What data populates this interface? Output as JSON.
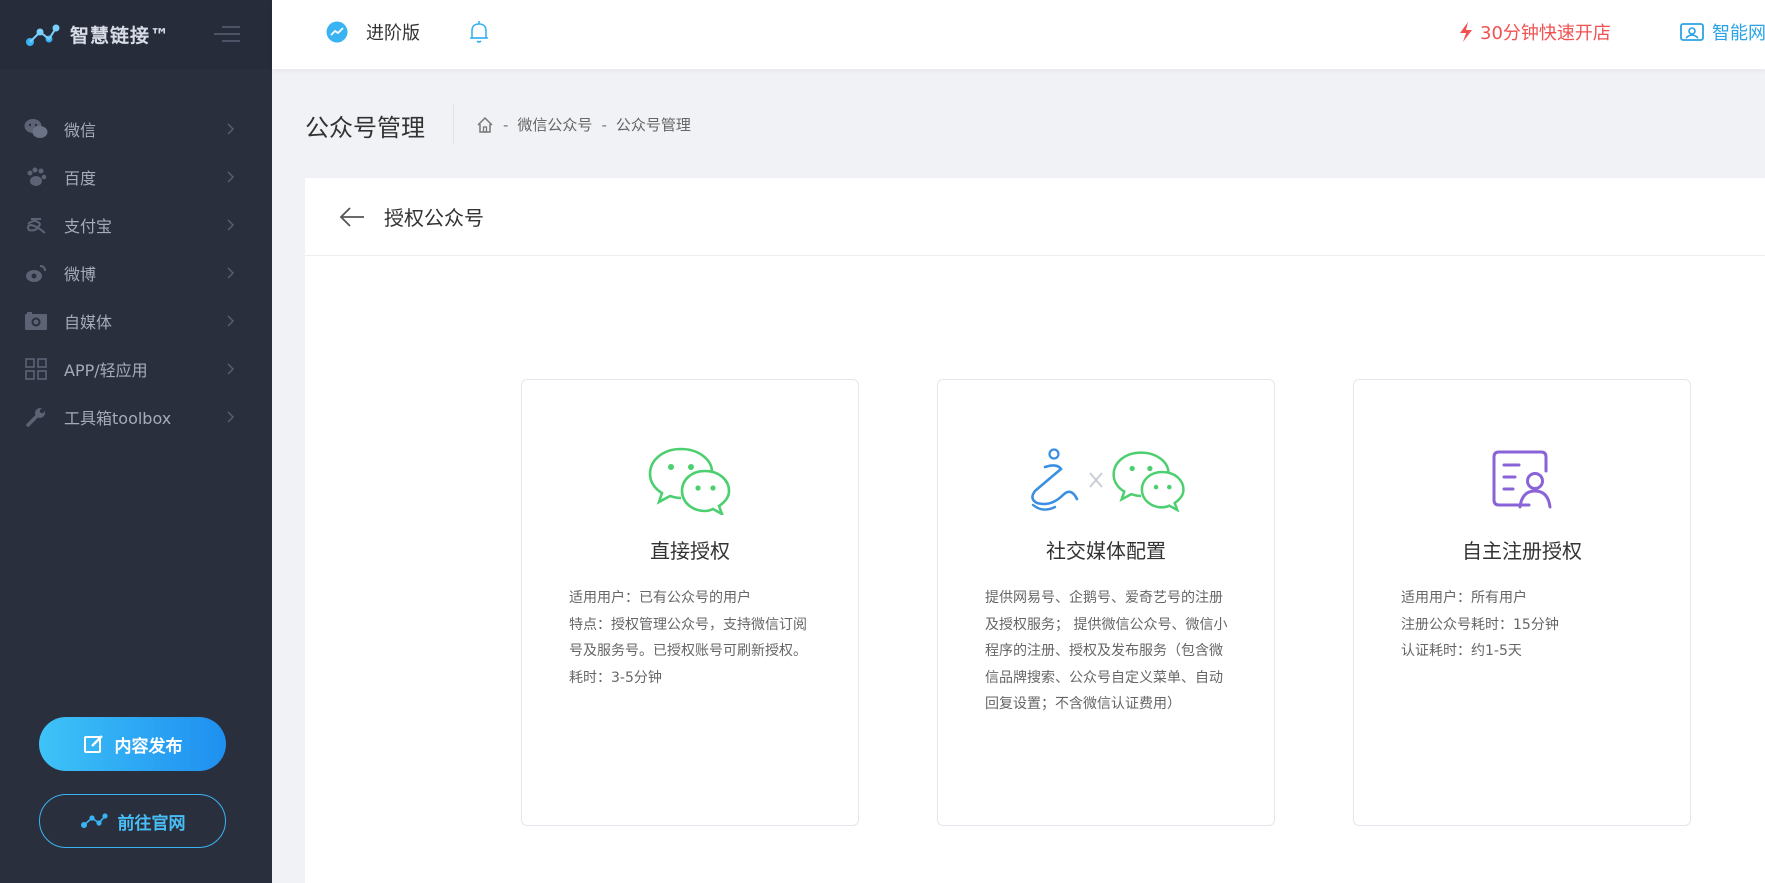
{
  "sidebar": {
    "brand": "智慧链接™",
    "items": [
      {
        "label": "微信",
        "icon": "wechat-icon"
      },
      {
        "label": "百度",
        "icon": "baidu-paw-icon"
      },
      {
        "label": "支付宝",
        "icon": "alipay-icon"
      },
      {
        "label": "微博",
        "icon": "weibo-icon"
      },
      {
        "label": "自媒体",
        "icon": "media-icon"
      },
      {
        "label": "APP/轻应用",
        "icon": "app-grid-icon"
      },
      {
        "label": "工具箱toolbox",
        "icon": "wrench-icon"
      }
    ],
    "publish_label": "内容发布",
    "site_label": "前往官网"
  },
  "topbar": {
    "edition": "进阶版",
    "quick_open": "30分钟快速开店",
    "smart": "智能网"
  },
  "header": {
    "title": "公众号管理",
    "breadcrumb": [
      "微信公众号",
      "公众号管理"
    ],
    "sep": "-"
  },
  "card": {
    "title": "授权公众号",
    "options": [
      {
        "title": "直接授权",
        "lines": [
          "适用用户：已有公众号的用户",
          "特点：授权管理公众号，支持微信订阅号及服务号。已授权账号可刷新授权。",
          "耗时：3-5分钟"
        ]
      },
      {
        "title": "社交媒体配置",
        "lines": [
          "提供网易号、企鹅号、爱奇艺号的注册及授权服务； 提供微信公众号、微信小程序的注册、授权及发布服务（包含微信品牌搜索、公众号自定义菜单、自动回复设置；不含微信认证费用）"
        ]
      },
      {
        "title": "自主注册授权",
        "lines": [
          "适用用户：所有用户",
          "注册公众号耗时：15分钟",
          "认证耗时：约1-5天"
        ]
      }
    ]
  },
  "colors": {
    "sidebar_bg": "#2a2f3d",
    "accent_blue": "#29a3e6",
    "wechat_green": "#4ccf6f",
    "alert_red": "#f05252",
    "purple": "#8a63d9"
  }
}
